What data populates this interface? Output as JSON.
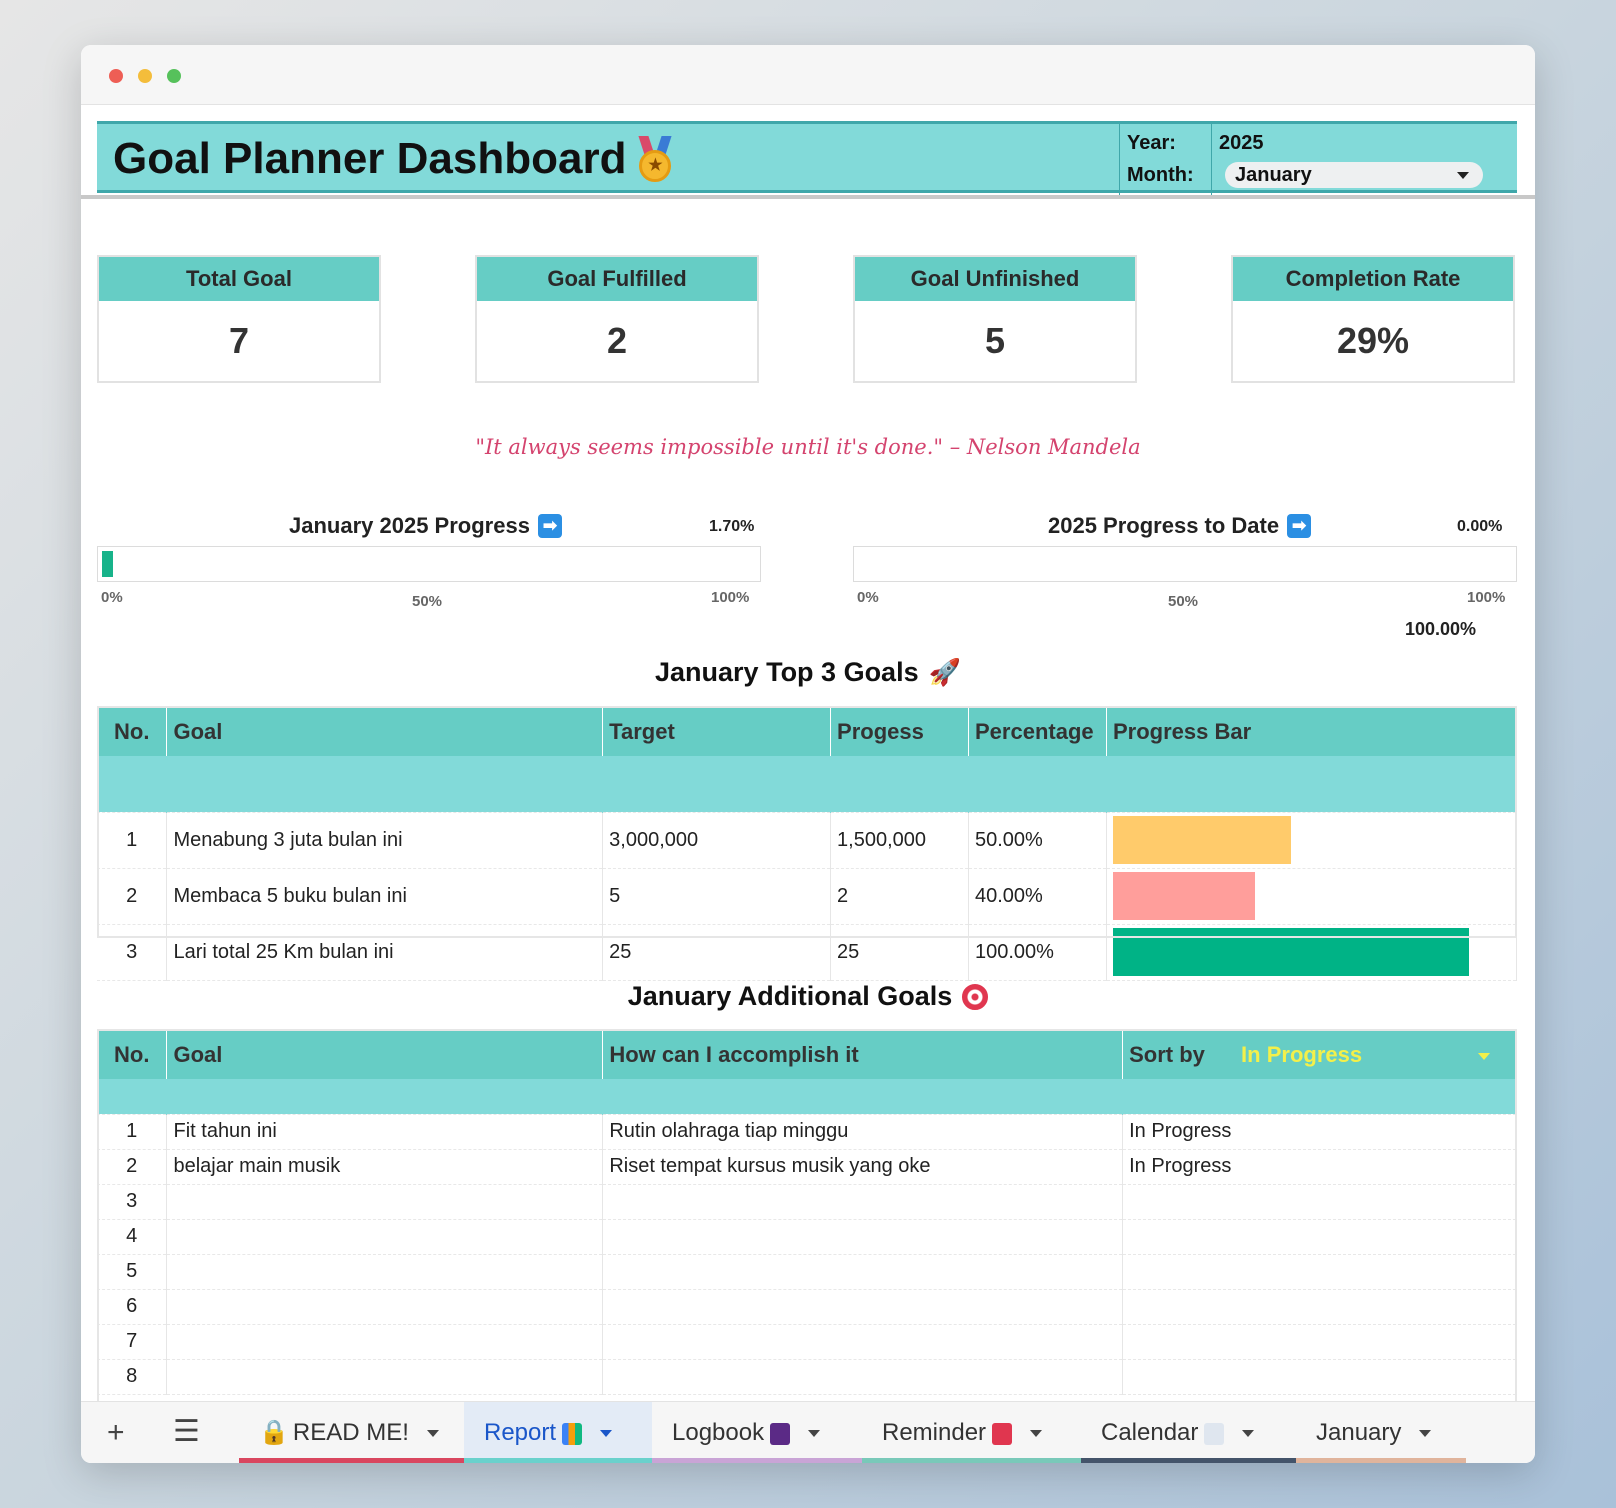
{
  "header": {
    "title": "Goal Planner Dashboard",
    "year_label": "Year:",
    "year_value": "2025",
    "month_label": "Month:",
    "month_value": "January"
  },
  "stats": [
    {
      "label": "Total Goal",
      "value": "7"
    },
    {
      "label": "Goal Fulfilled",
      "value": "2"
    },
    {
      "label": "Goal Unfinished",
      "value": "5"
    },
    {
      "label": "Completion Rate",
      "value": "29%"
    }
  ],
  "quote": "\"It always seems impossible until it's done.\" – Nelson Mandela",
  "progress": {
    "month": {
      "title": "January 2025 Progress",
      "pct_text": "1.70%",
      "value": 0.017
    },
    "year": {
      "title": "2025 Progress to Date",
      "pct_text": "0.00%",
      "value": 0.0,
      "extra": "100.00%"
    },
    "ticks": [
      "0%",
      "50%",
      "100%"
    ]
  },
  "top_goals": {
    "title": "January Top 3 Goals",
    "columns": [
      "No.",
      "Goal",
      "Target",
      "Progess",
      "Percentage",
      "Progress Bar"
    ],
    "rows": [
      {
        "no": "1",
        "goal": "Menabung 3 juta bulan ini",
        "target": "3,000,000",
        "progress": "1,500,000",
        "percentage": "50.00%",
        "value": 0.5,
        "color": "#ffcb6b"
      },
      {
        "no": "2",
        "goal": "Membaca 5 buku bulan ini",
        "target": "5",
        "progress": "2",
        "percentage": "40.00%",
        "value": 0.4,
        "color": "#ff9e9b"
      },
      {
        "no": "3",
        "goal": "Lari total 25 Km bulan ini",
        "target": "25",
        "progress": "25",
        "percentage": "100.00%",
        "value": 1.0,
        "color": "#00b386"
      }
    ]
  },
  "additional_goals": {
    "title": "January Additional Goals",
    "columns": [
      "No.",
      "Goal",
      "How can I accomplish it",
      "Sort by"
    ],
    "sort_value": "In Progress",
    "rows": [
      {
        "no": "1",
        "goal": "Fit tahun ini",
        "how": "Rutin olahraga tiap minggu",
        "status": "In Progress"
      },
      {
        "no": "2",
        "goal": "belajar main musik",
        "how": "Riset tempat kursus musik yang oke",
        "status": "In Progress"
      },
      {
        "no": "3",
        "goal": "",
        "how": "",
        "status": ""
      },
      {
        "no": "4",
        "goal": "",
        "how": "",
        "status": ""
      },
      {
        "no": "5",
        "goal": "",
        "how": "",
        "status": ""
      },
      {
        "no": "6",
        "goal": "",
        "how": "",
        "status": ""
      },
      {
        "no": "7",
        "goal": "",
        "how": "",
        "status": ""
      },
      {
        "no": "8",
        "goal": "",
        "how": "",
        "status": ""
      }
    ]
  },
  "tabs": [
    {
      "label": "READ ME!",
      "icon": "lock-icon",
      "color": "#d9465f"
    },
    {
      "label": "Report",
      "icon": "bar-chart-icon",
      "color": "#6ad1cc",
      "active": true
    },
    {
      "label": "Logbook",
      "icon": "notebook-icon",
      "color": "#c9a4d6"
    },
    {
      "label": "Reminder",
      "icon": "pushpin-icon",
      "color": "#79c9b9"
    },
    {
      "label": "Calendar",
      "icon": "calendar-icon",
      "color": "#44546a"
    },
    {
      "label": "January",
      "icon": "",
      "color": "#e0b49c"
    }
  ]
}
